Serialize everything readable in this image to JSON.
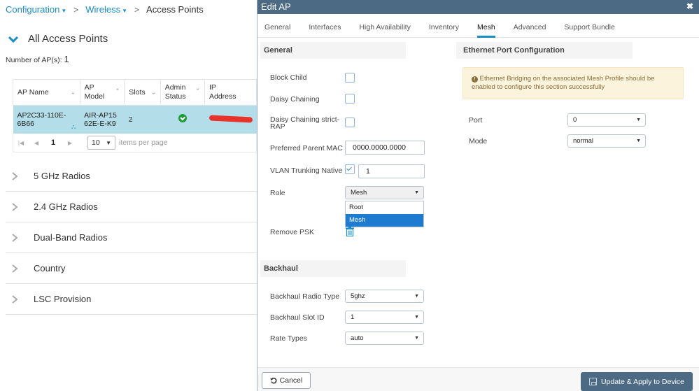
{
  "breadcrumb": {
    "items": [
      {
        "label": "Configuration",
        "dropdown": true
      },
      {
        "label": "Wireless",
        "dropdown": true
      },
      {
        "label": "Access Points",
        "dropdown": false
      }
    ],
    "separator": ">"
  },
  "left": {
    "section_title": "All Access Points",
    "count_label": "Number of AP(s):",
    "count_value": "1",
    "table": {
      "columns": [
        "AP Name",
        "AP Model",
        "Slots",
        "Admin Status",
        "IP Address"
      ],
      "rows": [
        {
          "ap_name": "AP2C33-110E-6B66",
          "ap_model": "AIR-AP1562E-E-K9",
          "slots": "2",
          "admin_status": "enabled",
          "ip_address": "[redacted]"
        }
      ]
    },
    "pager": {
      "current_page": "1",
      "per_page": "10",
      "per_page_label": "items per page"
    },
    "collapsed_sections": [
      "5 GHz Radios",
      "2.4 GHz Radios",
      "Dual-Band Radios",
      "Country",
      "LSC Provision"
    ]
  },
  "modal": {
    "title": "Edit AP",
    "close_icon": "close-icon",
    "tabs": [
      {
        "label": "General",
        "active": false
      },
      {
        "label": "Interfaces",
        "active": false
      },
      {
        "label": "High Availability",
        "active": false
      },
      {
        "label": "Inventory",
        "active": false
      },
      {
        "label": "Mesh",
        "active": true
      },
      {
        "label": "Advanced",
        "active": false
      },
      {
        "label": "Support Bundle",
        "active": false
      }
    ],
    "general": {
      "heading": "General",
      "block_child": {
        "label": "Block Child",
        "checked": false
      },
      "daisy_chaining": {
        "label": "Daisy Chaining",
        "checked": false
      },
      "daisy_strict": {
        "label": "Daisy Chaining strict-RAP",
        "label_line1": "Daisy Chaining strict-",
        "label_line2": "RAP",
        "checked": false
      },
      "preferred_parent": {
        "label": "Preferred Parent MAC",
        "value": "0000.0000.0000"
      },
      "vlan_trunking": {
        "label": "VLAN Trunking Native",
        "checked": true,
        "value": "1"
      },
      "role": {
        "label": "Role",
        "value": "Mesh",
        "options": [
          "Root",
          "Mesh"
        ],
        "highlighted": "Mesh"
      },
      "remove_psk": {
        "label": "Remove PSK"
      }
    },
    "backhaul": {
      "heading": "Backhaul",
      "radio_type": {
        "label": "Backhaul Radio Type",
        "value": "5ghz"
      },
      "slot_id": {
        "label": "Backhaul Slot ID",
        "value": "1"
      },
      "rate_types": {
        "label": "Rate Types",
        "value": "auto"
      }
    },
    "ethernet": {
      "heading": "Ethernet Port Configuration",
      "warning": "Ethernet Bridging on the associated Mesh Profile should be enabled to configure this section successfully",
      "warning_line1": "Ethernet Bridging on the associated Mesh Profile should be",
      "warning_line2": "enabled to configure this section successfully",
      "port": {
        "label": "Port",
        "value": "0"
      },
      "mode": {
        "label": "Mode",
        "value": "normal"
      }
    },
    "footer": {
      "cancel_label": "Cancel",
      "apply_label": "Update & Apply to Device"
    }
  },
  "colors": {
    "accent": "#1a8dc9",
    "header_bg": "#4c6a84",
    "selected_row": "#b3dde8",
    "status_ok": "#1f9b3a",
    "dropdown_selected": "#1e7bd0",
    "warning_bg": "#fcf3dc"
  }
}
